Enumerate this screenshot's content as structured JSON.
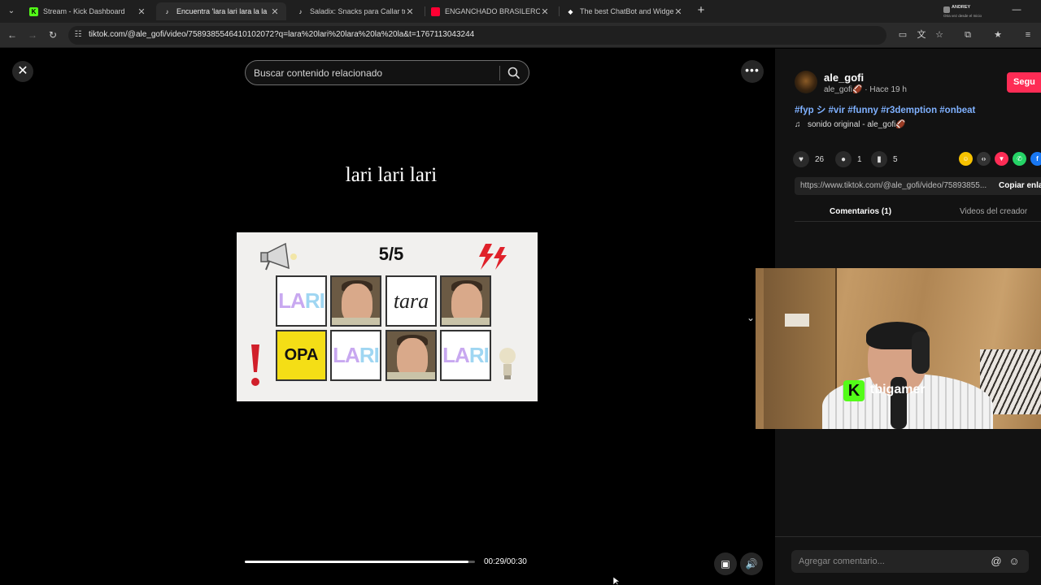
{
  "browser": {
    "tabs": [
      {
        "title": "Stream - Kick Dashboard",
        "favicon": "kick-icon",
        "color": "#53fc18",
        "active": false
      },
      {
        "title": "Encuentra 'lara lari lara la la",
        "favicon": "tiktok-icon",
        "color": "#ffffff",
        "active": true
      },
      {
        "title": "Saladix: Snacks para Callar tu H",
        "favicon": "tiktok-icon",
        "color": "#ffffff",
        "active": false
      },
      {
        "title": "ENGANCHADO BRASILERO FU",
        "favicon": "youtube-icon",
        "color": "#ff0033",
        "active": false
      },
      {
        "title": "The best ChatBot and Widgets",
        "favicon": "diamond-icon",
        "color": "#ffffff",
        "active": false
      }
    ],
    "profile": {
      "name": "ANDREY",
      "subtitle": "Otra vez desde el Inicio"
    },
    "url": "tiktok.com/@ale_gofi/video/7589385546410102072?q=lara%20lari%20lara%20la%20la&t=1767113043244"
  },
  "search": {
    "placeholder": "Buscar contenido relacionado"
  },
  "video": {
    "caption": "lari lari lari",
    "game_score": "5/5",
    "cards": {
      "lari": "LARI",
      "opa": "OPA",
      "tara": "tara"
    },
    "progress_fraction": 0.97,
    "timecode": "00:29/00:30"
  },
  "post": {
    "username": "ale_gofi",
    "handle": "ale_gofi🏈",
    "time": "· Hace 19 h",
    "follow_label": "Segu",
    "hashtags": "#fyp シ #vir #funny #r3demption #onbeat",
    "sound": "sonido original - ale_gofi🏈",
    "likes": "26",
    "comments": "1",
    "saves": "5",
    "link": "https://www.tiktok.com/@ale_gofi/video/75893855...",
    "copy_label": "Copiar enla",
    "tab_comments": "Comentarios (1)",
    "tab_creator": "Videos del creador",
    "comment_placeholder": "Agregar comentario..."
  },
  "stream": {
    "channel": "tbigamer",
    "brand_color": "#53fc18"
  },
  "colors": {
    "accent": "#fe2c55",
    "hashtag": "#7fb1ff"
  }
}
